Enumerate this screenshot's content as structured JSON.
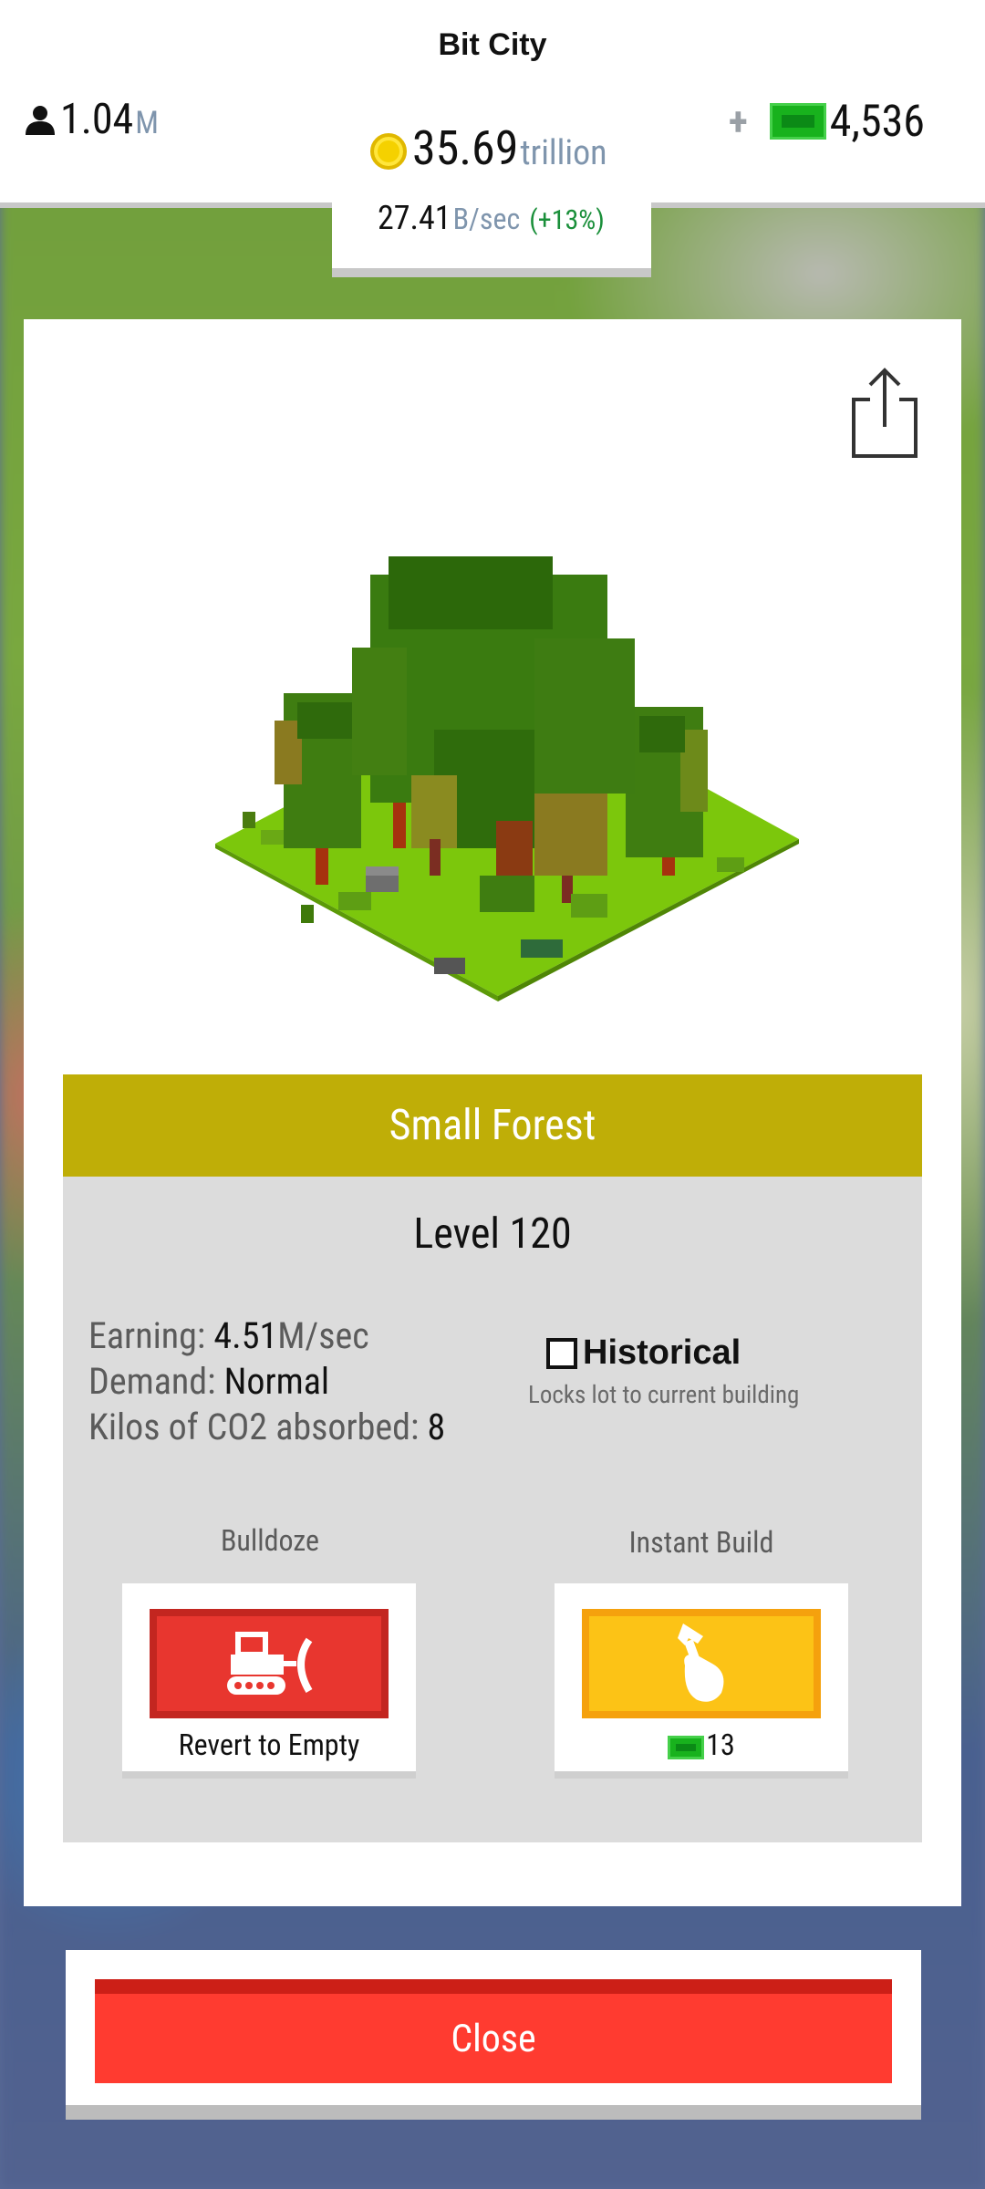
{
  "header": {
    "title": "Bit City",
    "population": {
      "value": "1.04",
      "unit": "M"
    },
    "cash": {
      "plus": "+",
      "value": "4,536"
    },
    "coins": {
      "value": "35.69",
      "unit": "trillion"
    },
    "rate": {
      "value": "27.41",
      "unit": "B/sec",
      "percent": "(+13%)"
    }
  },
  "lot": {
    "name": "Small Forest",
    "level": "Level 120",
    "stats": {
      "earning_label": "Earning: ",
      "earning_value": "4.51",
      "earning_unit": "M/sec",
      "demand_label": "Demand: ",
      "demand_value": "Normal",
      "co2_label": "Kilos of CO2 absorbed: ",
      "co2_value": "8"
    },
    "historical": {
      "label": "Historical",
      "checked": false,
      "subtitle": "Locks lot to current building"
    }
  },
  "actions": {
    "bulldoze": {
      "label": "Bulldoze",
      "caption": "Revert to Empty"
    },
    "instant_build": {
      "label": "Instant Build",
      "cost": "13"
    }
  },
  "close_label": "Close",
  "colors": {
    "name_bar": "#bfae07",
    "bulldoze_button": "#e8362f",
    "instant_build_button": "#fcc316",
    "close_button": "#ff3b30",
    "cash_green": "#18b21d"
  }
}
